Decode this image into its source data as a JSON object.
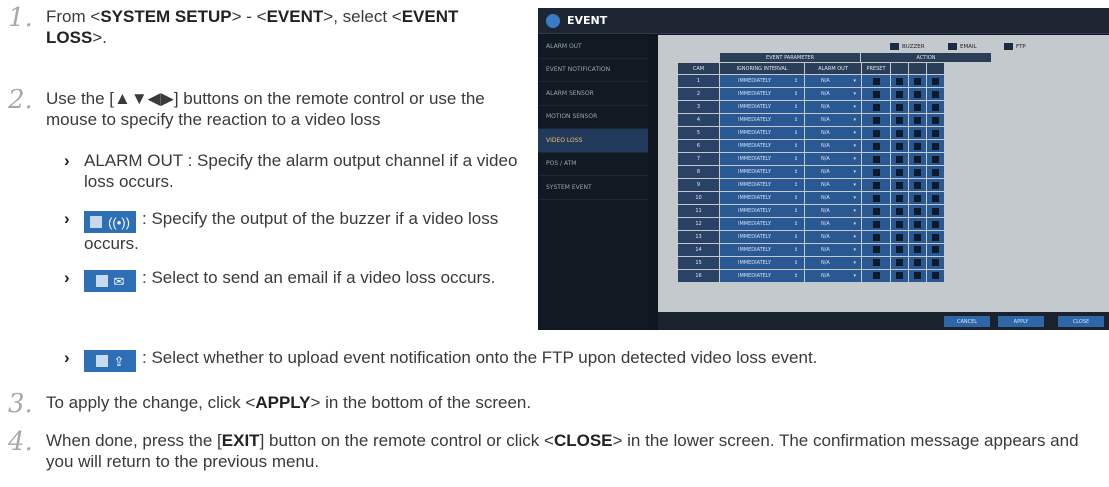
{
  "steps": [
    {
      "num": "1.",
      "parts": [
        [
          "t",
          "From <"
        ],
        [
          "b",
          "SYSTEM SETUP"
        ],
        [
          "t",
          "> - <"
        ],
        [
          "b",
          "EVENT"
        ],
        [
          "t",
          ">, select <"
        ],
        [
          "b",
          "EVENT LOSS"
        ],
        [
          "t",
          ">."
        ]
      ]
    },
    {
      "num": "2.",
      "text": "Use the [▲▼◀▶] buttons on the remote control or use the mouse to specify the reaction to a video loss"
    },
    {
      "num": "3.",
      "parts": [
        [
          "t",
          "To apply the change, click <"
        ],
        [
          "b",
          "APPLY"
        ],
        [
          "t",
          "> in the bottom of the screen."
        ]
      ]
    },
    {
      "num": "4.",
      "parts": [
        [
          "t",
          "When done, press the ["
        ],
        [
          "b",
          "EXIT"
        ],
        [
          "t",
          "] button on the remote control or click <"
        ],
        [
          "b",
          "CLOSE"
        ],
        [
          "t",
          "> in the lower screen. The confirmation message appears and you will return to the previous menu."
        ]
      ]
    }
  ],
  "bullets": [
    {
      "text": "ALARM OUT : Specify the alarm output channel if a video loss occurs."
    },
    {
      "icon": "buzzer-icon",
      "glyph": "((•))",
      "text": ": Specify the output of the buzzer if a video loss occurs."
    },
    {
      "icon": "email-icon",
      "glyph": "✉",
      "text": ": Select to send an email if a video loss occurs."
    },
    {
      "icon": "ftp-icon",
      "glyph": "⇪",
      "text": ": Select whether to upload event notification onto the FTP upon detected video loss event."
    }
  ],
  "dvr": {
    "title": "EVENT",
    "sidebar": [
      "ALARM OUT",
      "EVENT NOTIFICATION",
      "ALARM SENSOR",
      "MOTION SENSOR",
      "VIDEO LOSS",
      "POS / ATM",
      "SYSTEM EVENT"
    ],
    "active_index": 4,
    "legend": {
      "buzzer": "BUZZER",
      "email": "EMAIL",
      "ftp": "FTP"
    },
    "headers": {
      "event_parameter": "EVENT PARAMETER",
      "action": "ACTION",
      "cam": "CAM",
      "ignoring_interval": "IGNORING INTERVAL",
      "alarm_out": "ALARM OUT",
      "preset": "PRESET"
    },
    "rows": [
      {
        "cam": "1",
        "interval": "IMMEDIATELY",
        "alarm": "N/A"
      },
      {
        "cam": "2",
        "interval": "IMMEDIATELY",
        "alarm": "N/A"
      },
      {
        "cam": "3",
        "interval": "IMMEDIATELY",
        "alarm": "N/A"
      },
      {
        "cam": "4",
        "interval": "IMMEDIATELY",
        "alarm": "N/A"
      },
      {
        "cam": "5",
        "interval": "IMMEDIATELY",
        "alarm": "N/A"
      },
      {
        "cam": "6",
        "interval": "IMMEDIATELY",
        "alarm": "N/A"
      },
      {
        "cam": "7",
        "interval": "IMMEDIATELY",
        "alarm": "N/A"
      },
      {
        "cam": "8",
        "interval": "IMMEDIATELY",
        "alarm": "N/A"
      },
      {
        "cam": "9",
        "interval": "IMMEDIATELY",
        "alarm": "N/A"
      },
      {
        "cam": "10",
        "interval": "IMMEDIATELY",
        "alarm": "N/A"
      },
      {
        "cam": "11",
        "interval": "IMMEDIATELY",
        "alarm": "N/A"
      },
      {
        "cam": "12",
        "interval": "IMMEDIATELY",
        "alarm": "N/A"
      },
      {
        "cam": "13",
        "interval": "IMMEDIATELY",
        "alarm": "N/A"
      },
      {
        "cam": "14",
        "interval": "IMMEDIATELY",
        "alarm": "N/A"
      },
      {
        "cam": "15",
        "interval": "IMMEDIATELY",
        "alarm": "N/A"
      },
      {
        "cam": "16",
        "interval": "IMMEDIATELY",
        "alarm": "N/A"
      }
    ],
    "buttons": {
      "cancel": "CANCEL",
      "apply": "APPLY",
      "close": "CLOSE"
    }
  },
  "colors": {
    "accent": "#2d6fb4",
    "step_number": "#a8a8a8",
    "text": "#3a3a3a"
  }
}
